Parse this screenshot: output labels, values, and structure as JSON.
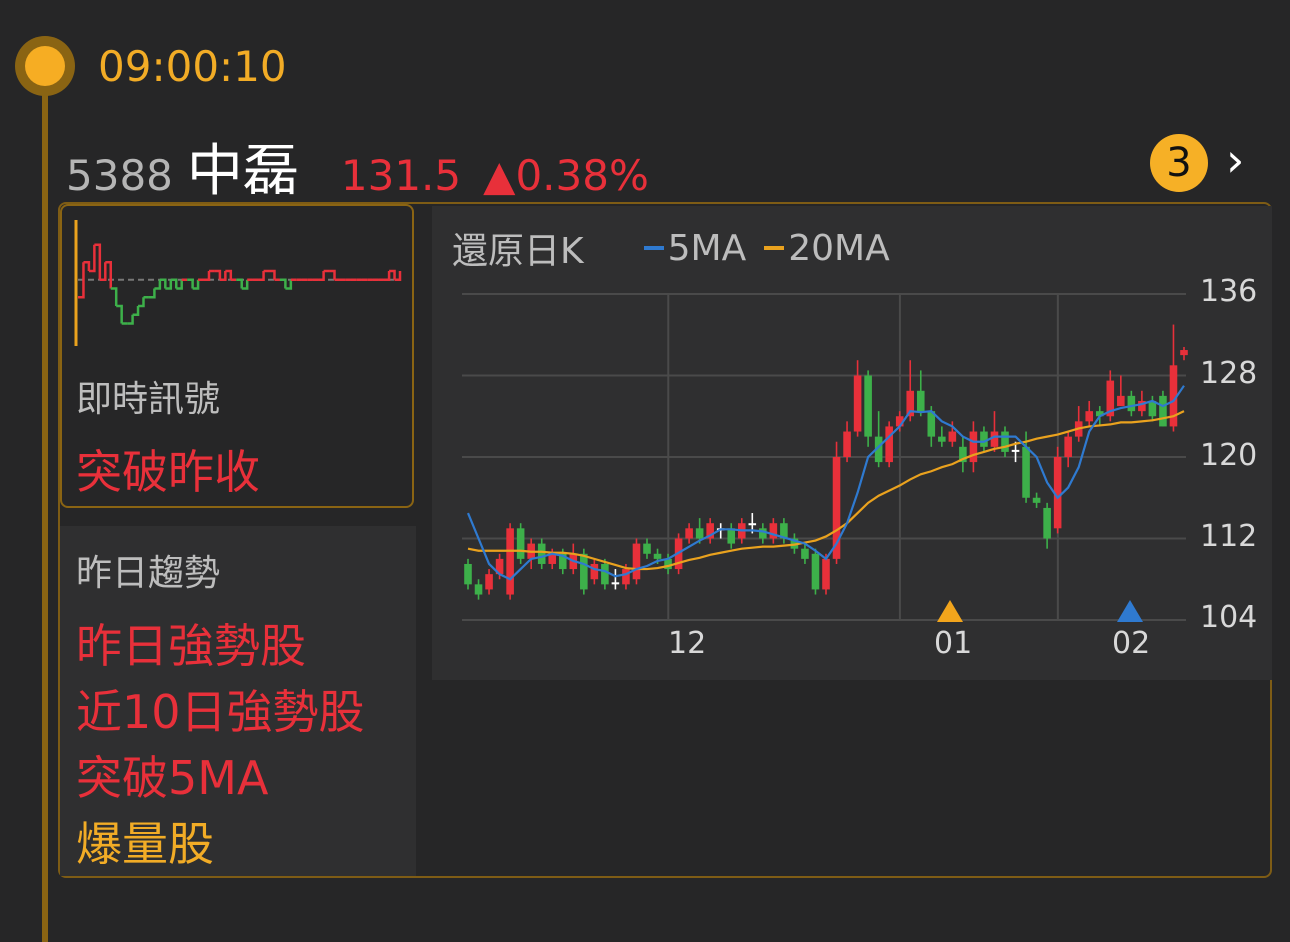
{
  "header": {
    "time": "09:00:10"
  },
  "stock": {
    "code": "5388",
    "name": "中磊",
    "price": "131.5",
    "change": "▲0.38%",
    "badge_count": "3",
    "chevron_icon": "chevron-right-icon"
  },
  "signal": {
    "title": "即時訊號",
    "value": "突破昨收"
  },
  "trend": {
    "title": "昨日趨勢",
    "items": [
      {
        "label": "昨日強勢股",
        "color": "#e8303a"
      },
      {
        "label": "近10日強勢股",
        "color": "#e8303a"
      },
      {
        "label": "突破5MA",
        "color": "#e8303a"
      },
      {
        "label": "爆量股",
        "color": "#f2ac26"
      }
    ]
  },
  "chart": {
    "title": "還原日K",
    "legend_5ma": "5MA",
    "legend_20ma": "20MA"
  },
  "colors": {
    "up": "#e8303a",
    "down": "#3db04a",
    "ma5": "#2f7ad0",
    "ma20": "#eaa21e",
    "accent": "#f6ad23"
  },
  "chart_data": [
    {
      "type": "line",
      "name": "intraday",
      "baseline": 131,
      "values": [
        129,
        133,
        132,
        135,
        131,
        133,
        130,
        128,
        126,
        126,
        127,
        128,
        129,
        129,
        130,
        131,
        130,
        131,
        130,
        131,
        131,
        130,
        131,
        131,
        132,
        132,
        131,
        132,
        131,
        131,
        130,
        131,
        131,
        131,
        132,
        132,
        131,
        131,
        130,
        131,
        131,
        131,
        131,
        131,
        131,
        132,
        132,
        131,
        131,
        131,
        131,
        131,
        131,
        131,
        131,
        131,
        131,
        132,
        131,
        132
      ]
    },
    {
      "type": "candlestick",
      "title": "還原日K",
      "ylim": [
        104,
        136
      ],
      "yticks": [
        104,
        112,
        120,
        128,
        136
      ],
      "xticks": [
        {
          "index": 18,
          "label": "12"
        },
        {
          "index": 40,
          "label": "01"
        },
        {
          "index": 55,
          "label": "02"
        }
      ],
      "candles": [
        [
          109.5,
          107.5,
          110.0,
          107.0
        ],
        [
          107.5,
          106.5,
          108.0,
          106.0
        ],
        [
          107.0,
          108.5,
          109.0,
          106.5
        ],
        [
          108.5,
          110.0,
          110.5,
          108.0
        ],
        [
          106.5,
          113.0,
          113.5,
          106.0
        ],
        [
          113.0,
          110.0,
          113.5,
          109.5
        ],
        [
          110.0,
          111.5,
          112.0,
          109.0
        ],
        [
          111.5,
          109.5,
          112.0,
          109.0
        ],
        [
          109.5,
          110.5,
          111.0,
          109.0
        ],
        [
          110.5,
          109.0,
          111.0,
          108.5
        ],
        [
          109.0,
          110.5,
          111.5,
          108.5
        ],
        [
          110.5,
          107.0,
          111.0,
          106.5
        ],
        [
          108.0,
          109.5,
          110.0,
          107.5
        ],
        [
          109.5,
          107.5,
          110.0,
          107.0
        ],
        [
          107.5,
          107.7,
          109.0,
          107.0
        ],
        [
          107.5,
          109.0,
          109.5,
          107.0
        ],
        [
          108.0,
          111.5,
          112.0,
          107.5
        ],
        [
          111.5,
          110.5,
          112.0,
          110.0
        ],
        [
          110.5,
          110.0,
          111.0,
          109.5
        ],
        [
          110.0,
          109.0,
          110.5,
          108.5
        ],
        [
          109.0,
          112.0,
          112.5,
          108.5
        ],
        [
          112.0,
          113.0,
          113.5,
          111.5
        ],
        [
          113.0,
          112.0,
          114.0,
          111.5
        ],
        [
          112.0,
          113.5,
          114.0,
          111.5
        ],
        [
          113.0,
          112.8,
          113.5,
          112.0
        ],
        [
          113.0,
          111.5,
          113.5,
          111.0
        ],
        [
          112.0,
          113.5,
          114.0,
          111.5
        ],
        [
          113.5,
          113.3,
          114.5,
          112.5
        ],
        [
          113.0,
          112.0,
          113.5,
          111.5
        ],
        [
          112.0,
          113.5,
          114.0,
          111.5
        ],
        [
          113.5,
          112.0,
          114.0,
          111.5
        ],
        [
          112.0,
          111.0,
          112.5,
          110.5
        ],
        [
          111.0,
          110.0,
          111.5,
          109.5
        ],
        [
          110.5,
          107.0,
          111.0,
          106.5
        ],
        [
          107.0,
          110.0,
          110.5,
          106.5
        ],
        [
          110.0,
          120.0,
          121.5,
          109.5
        ],
        [
          120.0,
          122.5,
          123.5,
          119.5
        ],
        [
          122.5,
          128.0,
          129.5,
          122.0
        ],
        [
          128.0,
          122.0,
          128.5,
          121.0
        ],
        [
          122.0,
          119.5,
          124.5,
          119.0
        ],
        [
          119.5,
          123.0,
          123.5,
          119.0
        ],
        [
          123.0,
          124.0,
          124.5,
          122.5
        ],
        [
          124.0,
          126.5,
          129.5,
          123.5
        ],
        [
          126.5,
          124.5,
          128.5,
          124.0
        ],
        [
          124.5,
          122.0,
          125.0,
          121.0
        ],
        [
          122.0,
          121.5,
          123.0,
          121.0
        ],
        [
          121.5,
          122.5,
          123.5,
          121.0
        ],
        [
          121.0,
          119.5,
          122.0,
          118.5
        ],
        [
          119.5,
          122.5,
          123.5,
          118.5
        ],
        [
          122.5,
          121.0,
          123.0,
          120.5
        ],
        [
          121.0,
          122.5,
          124.5,
          120.5
        ],
        [
          122.5,
          120.5,
          123.0,
          120.0
        ],
        [
          120.5,
          120.7,
          121.5,
          119.5
        ],
        [
          121.0,
          116.0,
          122.5,
          115.5
        ],
        [
          116.0,
          115.5,
          116.5,
          115.0
        ],
        [
          115.0,
          112.0,
          115.5,
          111.0
        ],
        [
          113.0,
          120.0,
          121.0,
          112.5
        ],
        [
          120.0,
          122.0,
          122.5,
          119.0
        ],
        [
          122.0,
          123.5,
          125.0,
          121.5
        ],
        [
          123.5,
          124.5,
          125.5,
          123.0
        ],
        [
          124.5,
          124.0,
          125.0,
          123.0
        ],
        [
          124.0,
          127.5,
          128.5,
          123.5
        ],
        [
          125.0,
          126.0,
          128.0,
          125.0
        ],
        [
          126.0,
          124.5,
          126.5,
          124.0
        ],
        [
          124.5,
          125.5,
          126.5,
          124.0
        ],
        [
          125.5,
          124.0,
          126.0,
          123.5
        ],
        [
          126.0,
          123.0,
          126.5,
          123.0
        ],
        [
          123.0,
          129.0,
          133.0,
          122.5
        ],
        [
          130.0,
          130.5,
          130.8,
          129.5
        ]
      ],
      "ma5": [
        114.5,
        112.0,
        109.5,
        108.5,
        108.0,
        109.0,
        110.0,
        110.2,
        110.5,
        110.3,
        109.8,
        109.5,
        109.0,
        108.8,
        108.3,
        108.5,
        109.0,
        109.3,
        109.8,
        110.0,
        110.6,
        111.2,
        111.8,
        112.3,
        112.9,
        112.9,
        112.8,
        112.8,
        112.7,
        112.4,
        112.1,
        111.8,
        111.5,
        110.8,
        110.0,
        111.5,
        113.5,
        116.5,
        120.0,
        121.0,
        122.0,
        123.0,
        124.5,
        124.4,
        124.5,
        123.5,
        123.0,
        122.0,
        121.5,
        121.5,
        122.0,
        122.0,
        122.0,
        121.0,
        120.0,
        117.5,
        116.0,
        117.0,
        119.0,
        122.5,
        124.0,
        124.5,
        124.8,
        125.0,
        125.2,
        125.5,
        125.0,
        125.5,
        127.0
      ],
      "ma20": [
        111.0,
        110.8,
        110.8,
        110.8,
        110.8,
        110.8,
        110.7,
        110.7,
        110.6,
        110.6,
        110.5,
        110.3,
        110.0,
        109.7,
        109.4,
        109.1,
        109.0,
        109.0,
        109.1,
        109.3,
        109.6,
        109.9,
        110.1,
        110.4,
        110.6,
        110.8,
        111.0,
        111.1,
        111.2,
        111.2,
        111.3,
        111.4,
        111.6,
        111.8,
        112.2,
        112.8,
        113.5,
        114.5,
        115.5,
        116.2,
        116.7,
        117.2,
        117.8,
        118.3,
        118.6,
        119.0,
        119.3,
        119.8,
        120.2,
        120.5,
        120.8,
        121.0,
        121.3,
        121.5,
        121.8,
        122.0,
        122.2,
        122.5,
        122.8,
        123.0,
        123.1,
        123.2,
        123.4,
        123.4,
        123.5,
        123.6,
        123.8,
        124.0,
        124.5
      ]
    }
  ]
}
